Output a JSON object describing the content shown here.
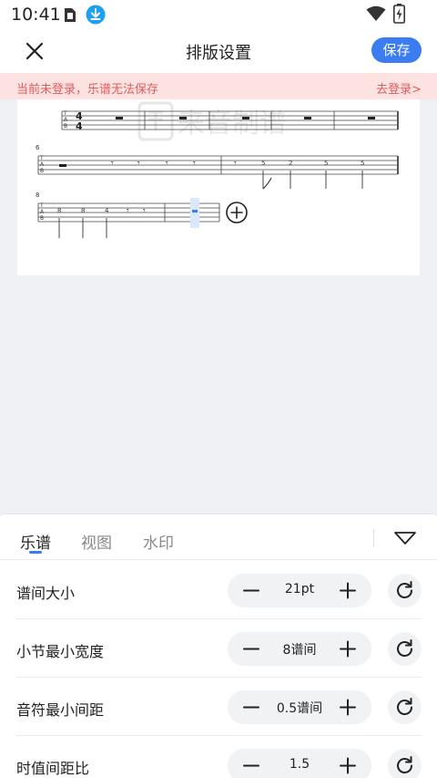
{
  "status_bar": {
    "time": "10:41",
    "icons": [
      "sim-card-icon",
      "download-icon",
      "wifi-icon",
      "battery-charging-icon"
    ],
    "download_icon_color": "#1ea0f2"
  },
  "header": {
    "title": "排版设置",
    "save_label": "保存",
    "close_icon": "close-icon",
    "accent_color": "#3b7cf0"
  },
  "login_banner": {
    "message": "当前未登录，乐谱无法保存",
    "link": "去登录>",
    "text_color": "#e35b5b",
    "background": "#fde2e2"
  },
  "score_preview": {
    "watermark_text": "来音制谱",
    "systems": [
      {
        "measure_number": "",
        "clef": "TAB",
        "time_signature": "4/4"
      },
      {
        "measure_number": "6",
        "clef": "TAB",
        "fret_numbers": [
          "5",
          "2",
          "5",
          "5"
        ]
      },
      {
        "measure_number": "8",
        "clef": "TAB",
        "fret_numbers": [
          "8",
          "8",
          "4"
        ]
      }
    ],
    "add_measure_icon": "circle-plus-icon"
  },
  "settings_panel": {
    "tabs": [
      {
        "label": "乐谱",
        "active": true
      },
      {
        "label": "视图",
        "active": false
      },
      {
        "label": "水印",
        "active": false
      }
    ],
    "collapse_icon": "triangle-down-icon",
    "rows": [
      {
        "label": "谱间大小",
        "value": "21pt"
      },
      {
        "label": "小节最小宽度",
        "value": "8谱间"
      },
      {
        "label": "音符最小间距",
        "value": "0.5谱间"
      },
      {
        "label": "时值间距比",
        "value": "1.5"
      }
    ],
    "minus_icon": "minus-icon",
    "plus_icon": "plus-icon",
    "reset_icon": "reset-icon"
  }
}
